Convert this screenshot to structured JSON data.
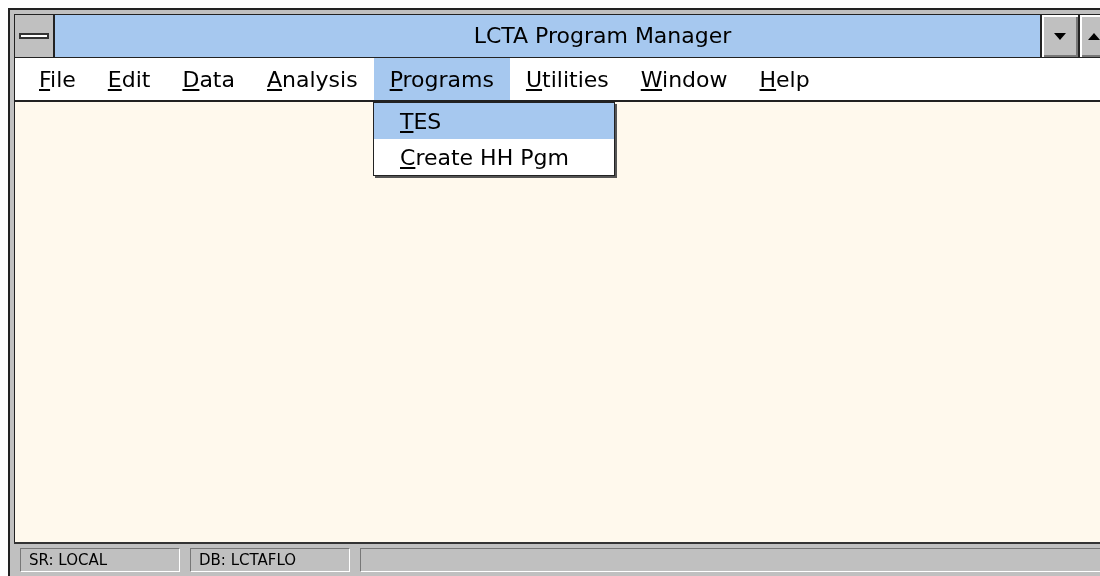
{
  "window": {
    "title": "LCTA Program Manager"
  },
  "menu": [
    {
      "label": "File",
      "selected": false
    },
    {
      "label": "Edit",
      "selected": false
    },
    {
      "label": "Data",
      "selected": false
    },
    {
      "label": "Analysis",
      "selected": false
    },
    {
      "label": "Programs",
      "selected": true
    },
    {
      "label": "Utilities",
      "selected": false
    },
    {
      "label": "Window",
      "selected": false
    },
    {
      "label": "Help",
      "selected": false
    }
  ],
  "dropdown": {
    "items": [
      {
        "label": "TES",
        "selected": true
      },
      {
        "label": "Create HH Pgm",
        "selected": false
      }
    ]
  },
  "status_bar": [
    "SR: LOCAL",
    "DB: LCTAFLO"
  ]
}
